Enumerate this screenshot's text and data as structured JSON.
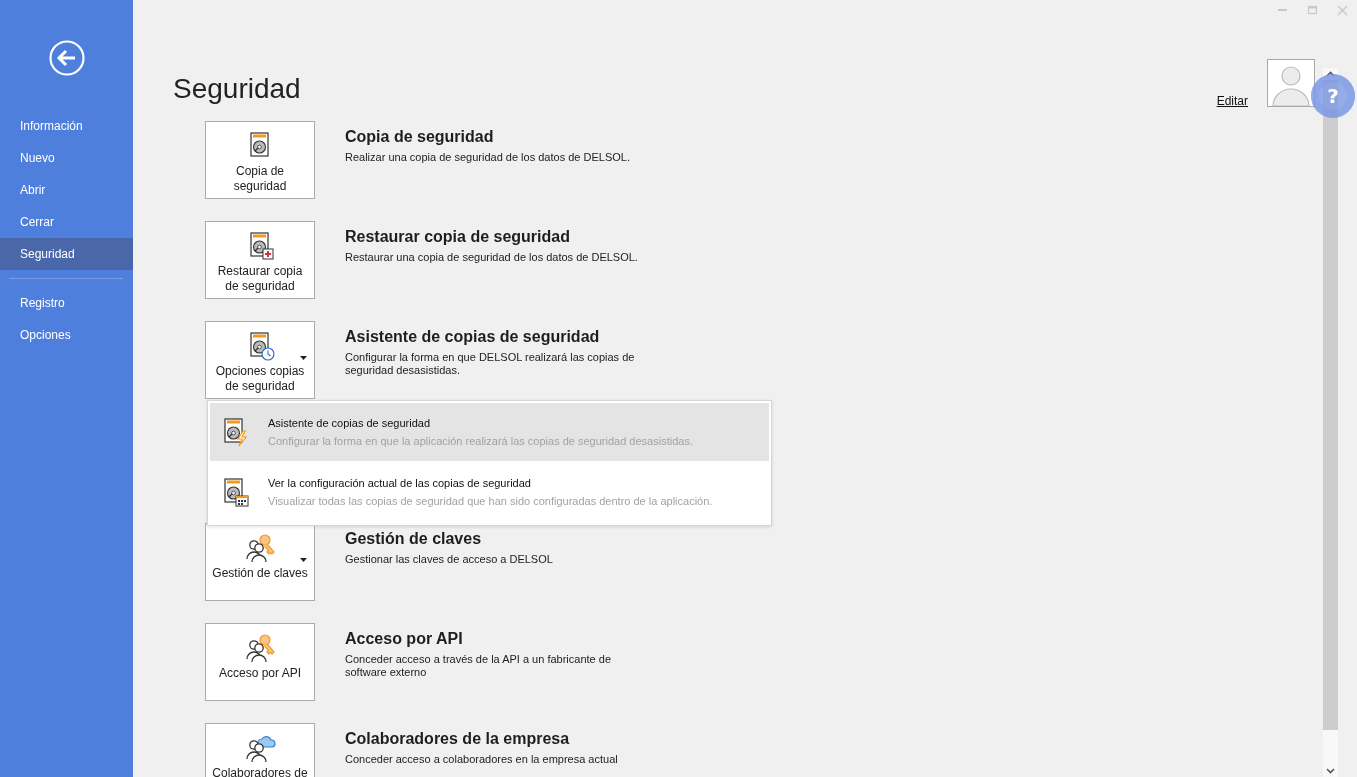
{
  "sidebar": {
    "groups": [
      [
        {
          "label": "Información",
          "selected": false
        },
        {
          "label": "Nuevo",
          "selected": false
        },
        {
          "label": "Abrir",
          "selected": false
        },
        {
          "label": "Cerrar",
          "selected": false
        },
        {
          "label": "Seguridad",
          "selected": true
        }
      ],
      [
        {
          "label": "Registro",
          "selected": false
        },
        {
          "label": "Opciones",
          "selected": false
        }
      ]
    ]
  },
  "page": {
    "title": "Seguridad"
  },
  "profile": {
    "edit_link": "Editar"
  },
  "help_button": {
    "label": "?"
  },
  "cards": [
    {
      "label": "Copia de seguridad",
      "title": "Copia de seguridad",
      "description": "Realizar una copia de seguridad de los datos de DELSOL.",
      "has_menu": false
    },
    {
      "label": "Restaurar copia de seguridad",
      "title": "Restaurar copia de seguridad",
      "description": "Restaurar una copia de seguridad de los datos de DELSOL.",
      "has_menu": false
    },
    {
      "label": "Opciones copias de seguridad",
      "title": "Asistente de copias de seguridad",
      "description": "Configurar la forma en que DELSOL realizará las copias de seguridad desasistidas.",
      "has_menu": true
    },
    {
      "label": "Gestión de claves",
      "title": "Gestión de claves",
      "description": "Gestionar las claves de acceso a DELSOL",
      "has_menu": true
    },
    {
      "label": "Acceso por API",
      "title": "Acceso por API",
      "description": "Conceder acceso a través de la API a un fabricante de software externo",
      "has_menu": false
    },
    {
      "label": "Colaboradores de",
      "title": "Colaboradores de la empresa",
      "description": "Conceder acceso a colaboradores en la empresa actual",
      "has_menu": false
    }
  ],
  "dropdown_menu": {
    "items": [
      {
        "title": "Asistente de copias de seguridad",
        "description": "Configurar la forma en que la aplicación realizará las copias de seguridad desasistidas.",
        "selected": true
      },
      {
        "title": "Ver la configuración actual de las copias de seguridad",
        "description": "Visualizar todas las copias de seguridad que han sido configuradas dentro de la aplicación.",
        "selected": false
      }
    ]
  }
}
